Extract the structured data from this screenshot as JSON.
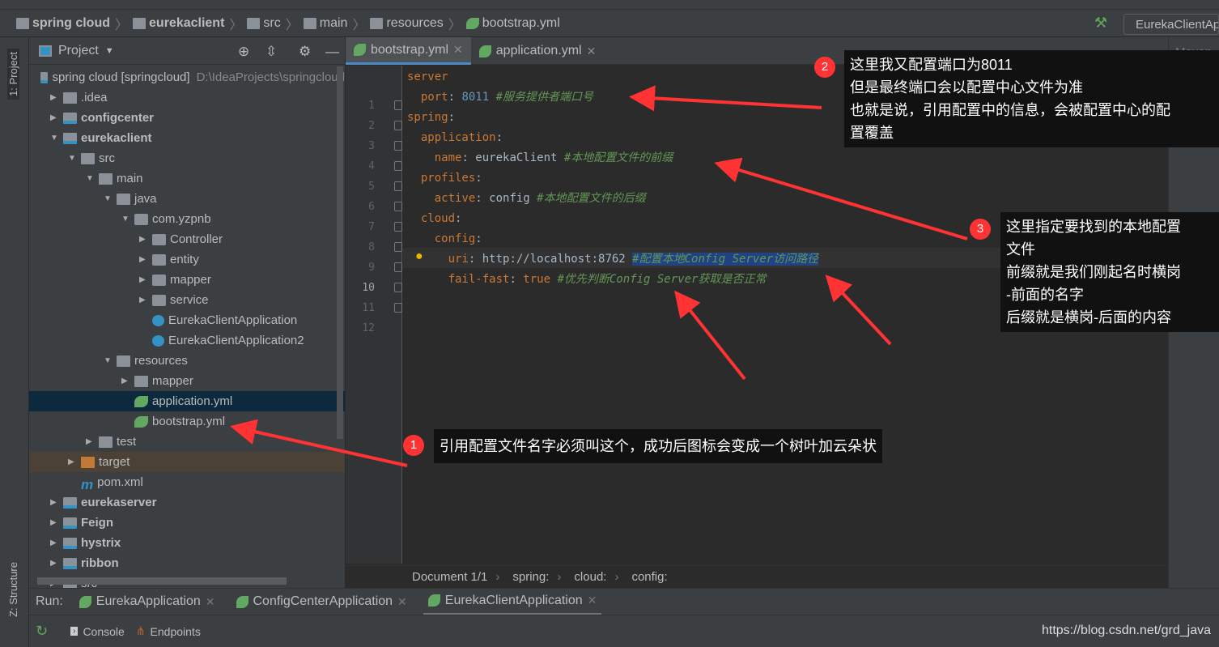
{
  "breadcrumb": [
    "spring cloud",
    "eurekaclient",
    "src",
    "main",
    "resources",
    "bootstrap.yml"
  ],
  "run_config": "EurekaClientApplication",
  "left_strip": {
    "project": "1: Project",
    "structure": "Z: Structure"
  },
  "project_panel": {
    "title": "Project",
    "tree": [
      {
        "level": 0,
        "arrow": "",
        "icon": "mod",
        "label": "spring cloud [springcloud]",
        "hint": "D:\\IdeaProjects\\springcloud",
        "bold": false
      },
      {
        "level": 1,
        "arrow": "right",
        "icon": "folder",
        "label": ".idea"
      },
      {
        "level": 1,
        "arrow": "right",
        "icon": "mod",
        "label": "configcenter",
        "bold": true
      },
      {
        "level": 1,
        "arrow": "down",
        "icon": "mod",
        "label": "eurekaclient",
        "bold": true
      },
      {
        "level": 2,
        "arrow": "down",
        "icon": "folder",
        "label": "src"
      },
      {
        "level": 3,
        "arrow": "down",
        "icon": "folder",
        "label": "main"
      },
      {
        "level": 4,
        "arrow": "down",
        "icon": "folder",
        "label": "java"
      },
      {
        "level": 5,
        "arrow": "down",
        "icon": "pkg",
        "label": "com.yzpnb"
      },
      {
        "level": 6,
        "arrow": "right",
        "icon": "pkg",
        "label": "Controller"
      },
      {
        "level": 6,
        "arrow": "right",
        "icon": "pkg",
        "label": "entity"
      },
      {
        "level": 6,
        "arrow": "right",
        "icon": "pkg",
        "label": "mapper"
      },
      {
        "level": 6,
        "arrow": "right",
        "icon": "pkg",
        "label": "service"
      },
      {
        "level": 6,
        "arrow": "",
        "icon": "cls",
        "label": "EurekaClientApplication"
      },
      {
        "level": 6,
        "arrow": "",
        "icon": "cls",
        "label": "EurekaClientApplication2"
      },
      {
        "level": 4,
        "arrow": "down",
        "icon": "folder",
        "label": "resources"
      },
      {
        "level": 5,
        "arrow": "right",
        "icon": "folder",
        "label": "mapper"
      },
      {
        "level": 5,
        "arrow": "",
        "icon": "leaf",
        "label": "application.yml",
        "selected": true
      },
      {
        "level": 5,
        "arrow": "",
        "icon": "leaf",
        "label": "bootstrap.yml"
      },
      {
        "level": 3,
        "arrow": "right",
        "icon": "folder",
        "label": "test"
      },
      {
        "level": 2,
        "arrow": "right",
        "icon": "tgt",
        "label": "target",
        "excluded": true
      },
      {
        "level": 2,
        "arrow": "",
        "icon": "mvn",
        "label": "pom.xml"
      },
      {
        "level": 1,
        "arrow": "right",
        "icon": "mod",
        "label": "eurekaserver",
        "bold": true
      },
      {
        "level": 1,
        "arrow": "right",
        "icon": "mod",
        "label": "Feign",
        "bold": true
      },
      {
        "level": 1,
        "arrow": "right",
        "icon": "mod",
        "label": "hystrix",
        "bold": true
      },
      {
        "level": 1,
        "arrow": "right",
        "icon": "mod",
        "label": "ribbon",
        "bold": true
      },
      {
        "level": 1,
        "arrow": "right",
        "icon": "folder",
        "label": "src"
      }
    ]
  },
  "editor": {
    "tabs": [
      {
        "label": "bootstrap.yml",
        "active": true
      },
      {
        "label": "application.yml"
      }
    ],
    "current_line": 10,
    "lines": [
      [
        [
          "k",
          "server"
        ],
        [
          "",
          "",
          ":"
        ]
      ],
      [
        [
          "",
          "  "
        ],
        [
          "k",
          "port"
        ],
        [
          "",
          ": "
        ],
        [
          "n",
          "8011"
        ],
        [
          "",
          ""
        ],
        [
          "c",
          " #服务提供者端口号"
        ]
      ],
      [
        [
          "k",
          "spring"
        ],
        [
          "",
          ":"
        ]
      ],
      [
        [
          "",
          "  "
        ],
        [
          "k",
          "application"
        ],
        [
          "",
          ":"
        ]
      ],
      [
        [
          "",
          "    "
        ],
        [
          "k",
          "name"
        ],
        [
          "",
          ": eurekaClient "
        ],
        [
          "c",
          "#本地配置文件的前缀"
        ]
      ],
      [
        [
          "",
          "  "
        ],
        [
          "k",
          "profiles"
        ],
        [
          "",
          ":"
        ]
      ],
      [
        [
          "",
          "    "
        ],
        [
          "k",
          "active"
        ],
        [
          "",
          ": config "
        ],
        [
          "c",
          "#本地配置文件的后缀"
        ]
      ],
      [
        [
          "",
          "  "
        ],
        [
          "k",
          "cloud"
        ],
        [
          "",
          ":"
        ]
      ],
      [
        [
          "",
          "    "
        ],
        [
          "k",
          "config"
        ],
        [
          "",
          ":"
        ]
      ],
      [
        [
          "",
          "      "
        ],
        [
          "k",
          "uri"
        ],
        [
          "",
          ": http://localhost:8762 "
        ],
        [
          "c s",
          "#配置本地Config Server访问路径"
        ]
      ],
      [
        [
          "",
          "      "
        ],
        [
          "k",
          "fail-fast"
        ],
        [
          "",
          ": "
        ],
        [
          "k",
          "true"
        ],
        [
          "c",
          " #优先判断Config Server获取是否正常"
        ]
      ],
      [
        [
          "",
          ""
        ]
      ]
    ],
    "status_breadcrumb": [
      "Document 1/1",
      "spring:",
      "cloud:",
      "config:"
    ]
  },
  "maven": {
    "title": "Maven"
  },
  "run_bar": {
    "label": "Run:",
    "tabs": [
      {
        "label": "EurekaApplication"
      },
      {
        "label": "ConfigCenterApplication"
      },
      {
        "label": "EurekaClientApplication",
        "active": true
      }
    ]
  },
  "console_bar": {
    "console": "Console",
    "endpoints": "Endpoints"
  },
  "watermark": "https://blog.csdn.net/grd_java",
  "annotations": [
    {
      "number": "1",
      "text": [
        "引用配置文件名字必须叫这个，成功后图标会变成一个树叶加云朵状"
      ]
    },
    {
      "number": "2",
      "text": [
        "这里我又配置端口为8011",
        "但是最终端口会以配置中心文件为准",
        "也就是说，引用配置中的信息，会被配置中心的配",
        "置覆盖"
      ]
    },
    {
      "number": "3",
      "text": [
        "这里指定要找到的本地配置",
        "文件",
        "前缀就是我们刚起名时横岗",
        "-前面的名字",
        "后缀就是横岗-后面的内容"
      ]
    }
  ],
  "colors": {
    "annotation_red": "#ff3333",
    "selection": "#214283",
    "keyword": "#cc7832",
    "comment": "#629755"
  }
}
